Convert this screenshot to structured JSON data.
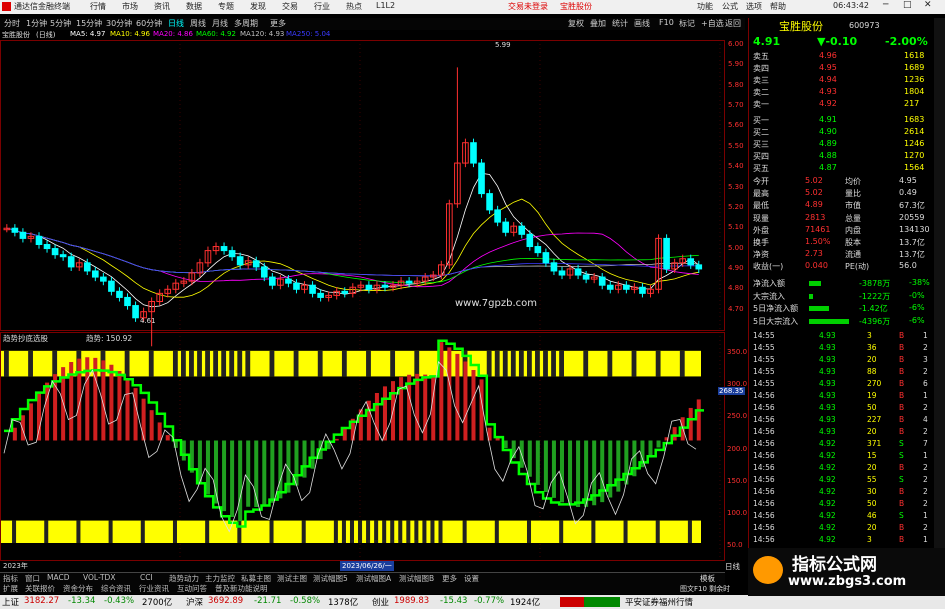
{
  "app": {
    "title": "通达信金融终端",
    "menu": [
      "行情",
      "市场",
      "资讯",
      "数据",
      "专题",
      "发现",
      "交易",
      "行业",
      "热点",
      "L1L2"
    ],
    "trade_login": "交易未登录",
    "stock_tag": "宝胜股份",
    "menu_right": [
      "功能",
      "公式",
      "选项",
      "帮助"
    ],
    "clock": "06:43:42"
  },
  "periods": [
    "分时",
    "1分钟",
    "5分钟",
    "15分钟",
    "30分钟",
    "60分钟",
    "日线",
    "周线",
    "月线",
    "多周期",
    "更多"
  ],
  "toolbar_right": [
    "复权",
    "叠加",
    "统计",
    "画线",
    "F10",
    "标记",
    "+自选",
    "返回"
  ],
  "stock": {
    "name": "宝胜股份",
    "period_label": "(日线)",
    "code": "600973",
    "price": "4.91",
    "change": "▼-0.10",
    "pct": "-2.00%"
  },
  "ma": [
    {
      "label": "MA5: 4.97",
      "color": "#ffffff"
    },
    {
      "label": "MA10: 4.96",
      "color": "#ffff00"
    },
    {
      "label": "MA20: 4.86",
      "color": "#ff00ff"
    },
    {
      "label": "MA60: 4.92",
      "color": "#00ff00"
    },
    {
      "label": "MA120: 4.93",
      "color": "#bfbfbf"
    },
    {
      "label": "MA250: 5.04",
      "color": "#0000ff"
    }
  ],
  "price_axis": [
    "6.00",
    "5.90",
    "5.80",
    "5.70",
    "5.60",
    "5.50",
    "5.40",
    "5.30",
    "5.20",
    "5.10",
    "5.00",
    "4.90",
    "4.80",
    "4.70"
  ],
  "price_marks": {
    "high": "5.99",
    "low": "4.61"
  },
  "site": "www.7gpzb.com",
  "indicator": {
    "name": "趋势抄底选股",
    "value_label": "趋势: 150.92",
    "right_value": "268.35"
  },
  "ind_axis": [
    "350.0",
    "300.0",
    "250.0",
    "200.0",
    "150.0",
    "100.0",
    "50.0"
  ],
  "date_labels": {
    "left": "2023年",
    "cursor": "2023/06/26/一"
  },
  "bottom_tabs": [
    "指标",
    "窗口",
    "MACD",
    "VOL-TDX",
    "CCI",
    "趋势动力",
    "主力监控",
    "私募主图",
    "测试主图",
    "测试幅图5",
    "测试幅图A",
    "测试幅图B",
    "更多",
    "设置"
  ],
  "bottom_tabs2": [
    "扩展",
    "关联报价",
    "资金分布",
    "综合资讯",
    "行业资讯",
    "互动问答",
    "普及新功能说明"
  ],
  "right_side_tabs": [
    "日线",
    "模板"
  ],
  "order_book": {
    "asks": [
      [
        "卖五",
        "4.96",
        "1618"
      ],
      [
        "卖四",
        "4.95",
        "1689"
      ],
      [
        "卖三",
        "4.94",
        "1236"
      ],
      [
        "卖二",
        "4.93",
        "1804"
      ],
      [
        "卖一",
        "4.92",
        "217"
      ]
    ],
    "bids": [
      [
        "买一",
        "4.91",
        "1683"
      ],
      [
        "买二",
        "4.90",
        "2614"
      ],
      [
        "买三",
        "4.89",
        "1246"
      ],
      [
        "买四",
        "4.88",
        "1270"
      ],
      [
        "买五",
        "4.87",
        "1564"
      ]
    ]
  },
  "quote": [
    [
      "今开",
      "5.02",
      "均价",
      "4.95"
    ],
    [
      "最高",
      "5.02",
      "量比",
      "0.49"
    ],
    [
      "最低",
      "4.89",
      "市值",
      "67.3亿"
    ],
    [
      "现量",
      "2813",
      "总量",
      "20559"
    ],
    [
      "外盘",
      "71461",
      "内盘",
      "134130"
    ],
    [
      "换手",
      "1.50%",
      "股本",
      "13.7亿"
    ],
    [
      "净资",
      "2.73",
      "流通",
      "13.7亿"
    ],
    [
      "收益(一)",
      "0.040",
      "PE(动)",
      "56.0"
    ]
  ],
  "flows": [
    [
      "净流入额",
      "-3878万",
      "-38%"
    ],
    [
      "大宗流入",
      "-1222万",
      "-0%"
    ],
    [
      "5日净流入额",
      "-1.42亿",
      "-6%"
    ],
    [
      "5日大宗流入",
      "-4396万",
      "-6%"
    ]
  ],
  "trades": [
    [
      "14:55",
      "4.93",
      "3",
      "B",
      "1"
    ],
    [
      "14:55",
      "4.93",
      "36",
      "B",
      "2"
    ],
    [
      "14:55",
      "4.93",
      "20",
      "B",
      "3"
    ],
    [
      "14:55",
      "4.93",
      "88",
      "B",
      "2"
    ],
    [
      "14:55",
      "4.93",
      "270",
      "B",
      "6"
    ],
    [
      "14:56",
      "4.93",
      "19",
      "B",
      "1"
    ],
    [
      "14:56",
      "4.93",
      "50",
      "B",
      "2"
    ],
    [
      "14:56",
      "4.93",
      "227",
      "B",
      "4"
    ],
    [
      "14:56",
      "4.93",
      "20",
      "B",
      "2"
    ],
    [
      "14:56",
      "4.92",
      "371",
      "S",
      "7"
    ],
    [
      "14:56",
      "4.92",
      "15",
      "S",
      "1"
    ],
    [
      "14:56",
      "4.92",
      "20",
      "B",
      "2"
    ],
    [
      "14:56",
      "4.92",
      "55",
      "S",
      "2"
    ],
    [
      "14:56",
      "4.92",
      "30",
      "B",
      "2"
    ],
    [
      "14:56",
      "4.92",
      "50",
      "B",
      "2"
    ],
    [
      "14:56",
      "4.92",
      "46",
      "S",
      "1"
    ],
    [
      "14:56",
      "4.92",
      "20",
      "B",
      "2"
    ],
    [
      "14:56",
      "4.92",
      "3",
      "B",
      "1"
    ]
  ],
  "status": {
    "sh_label": "上证",
    "sh": "3182.27",
    "sh_chg": "-13.34",
    "sh_pct": "-0.43%",
    "sh_amt": "2700亿",
    "sz_label": "沪深",
    "sz": "3692.89",
    "sz_chg": "-21.71",
    "sz_pct": "-0.58%",
    "sz_amt": "1378亿",
    "cy_label": "创业",
    "cy": "1989.83",
    "cy_chg": "-15.43",
    "cy_pct": "-0.77%",
    "cy_amt": "1924亿",
    "broker": "平安证券福州行情",
    "help": "图文F10 剩余时"
  },
  "watermark": {
    "title": "指标公式网",
    "url": "www.zbgs3.com"
  },
  "colors": {
    "up": "#ff3030",
    "down": "#00ff00",
    "ink": "#00ffff",
    "yellow_band": "#ffff00"
  }
}
